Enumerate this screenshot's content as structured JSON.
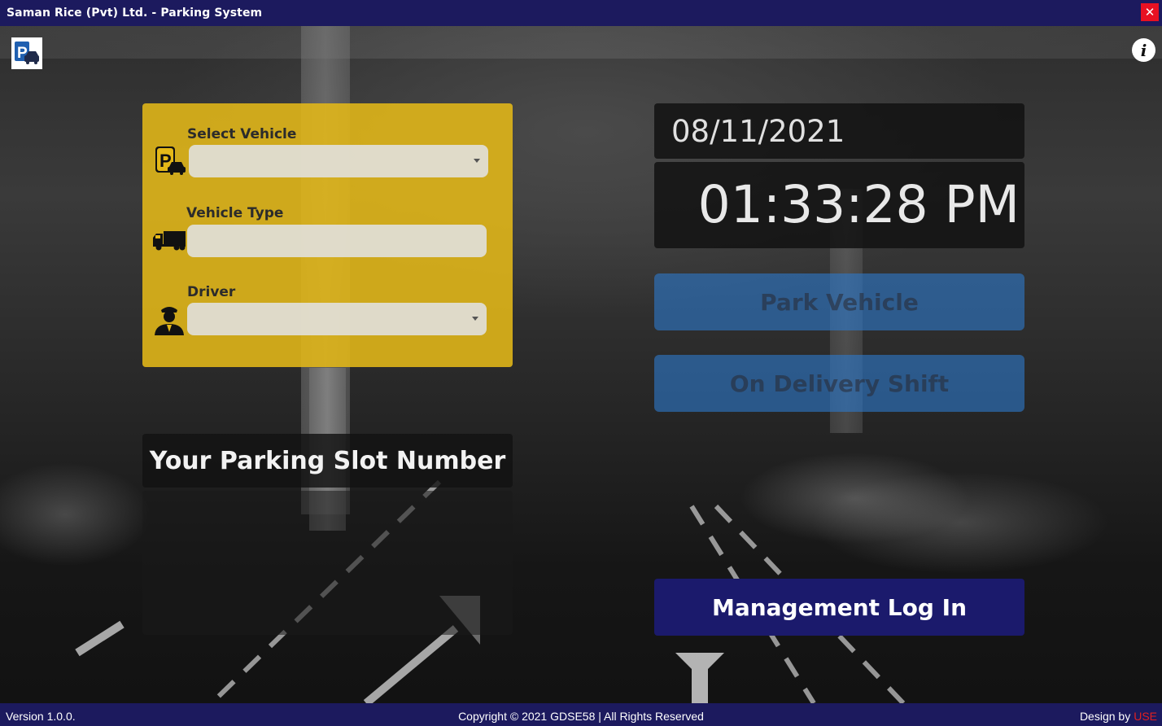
{
  "window": {
    "title": "Saman Rice (Pvt) Ltd. - Parking System",
    "close_glyph": "✕"
  },
  "header": {
    "info_glyph": "i"
  },
  "form": {
    "select_vehicle_label": "Select Vehicle",
    "select_vehicle_value": "",
    "vehicle_type_label": "Vehicle Type",
    "vehicle_type_value": "",
    "driver_label": "Driver",
    "driver_value": ""
  },
  "slot": {
    "title": "Your Parking Slot Number",
    "value": ""
  },
  "clock": {
    "date": "08/11/2021",
    "time": "01:33:28 PM"
  },
  "actions": {
    "park_label": "Park Vehicle",
    "delivery_label": "On Delivery Shift",
    "management_label": "Management Log In"
  },
  "footer": {
    "version": "Version 1.0.0.",
    "copyright": "Copyright © 2021 GDSE58 | All Rights Reserved",
    "design_prefix": "Design by",
    "design_brand": "USE"
  },
  "icons": {
    "app_logo": "parking-car-icon",
    "info": "info-icon",
    "select_vehicle": "parking-car-icon",
    "vehicle_type": "truck-icon",
    "driver": "driver-icon"
  },
  "colors": {
    "titlebar": "#1c1a5e",
    "panel_yellow": "#e4b818",
    "button_blue": "#2d78c8",
    "management_button": "#1b1a6c",
    "close_red": "#e81123",
    "brand_red": "#e02020"
  }
}
